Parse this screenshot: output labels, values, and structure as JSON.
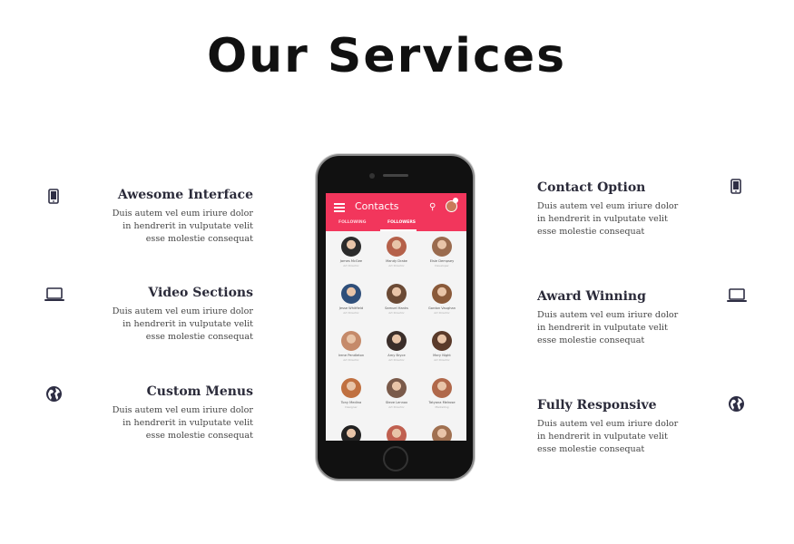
{
  "page": {
    "title": "Our Services"
  },
  "features_left": [
    {
      "title": "Awesome Interface",
      "text": "Duis autem vel eum iriure dolor in hendrerit in vulputate velit esse molestie consequat",
      "icon": "smartphone-icon"
    },
    {
      "title": "Video Sections",
      "text": "Duis autem vel eum iriure dolor in hendrerit in vulputate velit esse molestie consequat",
      "icon": "laptop-icon"
    },
    {
      "title": "Custom Menus",
      "text": "Duis autem vel eum iriure dolor in hendrerit in vulputate velit esse molestie consequat",
      "icon": "globe-icon"
    }
  ],
  "features_right": [
    {
      "title": "Contact Option",
      "text": "Duis autem vel eum iriure dolor in hendrerit in vulputate velit esse molestie consequat",
      "icon": "smartphone-icon"
    },
    {
      "title": "Award Winning",
      "text": "Duis autem vel eum iriure dolor in hendrerit in vulputate velit esse molestie consequat",
      "icon": "laptop-icon"
    },
    {
      "title": "Fully Responsive",
      "text": "Duis autem vel eum iriure dolor in hendrerit in vulputate velit esse molestie consequat",
      "icon": "globe-icon"
    }
  ],
  "phone_app": {
    "title": "Contacts",
    "accent_color": "#f2365c",
    "tabs": [
      "FOLLOWING",
      "FOLLOWERS"
    ],
    "active_tab": "FOLLOWERS",
    "contacts": [
      {
        "name": "James McGee",
        "sub": "Art Director"
      },
      {
        "name": "Mandy Drake",
        "sub": "Art Director"
      },
      {
        "name": "Elsie Dempsey",
        "sub": "Developer"
      },
      {
        "name": "Jesse Whitfield",
        "sub": "Art Director"
      },
      {
        "name": "Samuel Hanks",
        "sub": "Art Director"
      },
      {
        "name": "Gordon Vaughan",
        "sub": "Art Director"
      },
      {
        "name": "Irene Pendleton",
        "sub": "Art Director"
      },
      {
        "name": "Amy Bryce",
        "sub": "Art Director"
      },
      {
        "name": "Mary Night",
        "sub": "Art Director"
      },
      {
        "name": "Tony Medina",
        "sub": "Designer"
      },
      {
        "name": "Steve Lennox",
        "sub": "Art Director"
      },
      {
        "name": "Tatyana Melrose",
        "sub": "Marketing"
      },
      {
        "name": "",
        "sub": ""
      },
      {
        "name": "",
        "sub": ""
      },
      {
        "name": "",
        "sub": ""
      }
    ]
  },
  "colors": {
    "icon": "#2e2e44",
    "heading": "#2b2b3a"
  }
}
